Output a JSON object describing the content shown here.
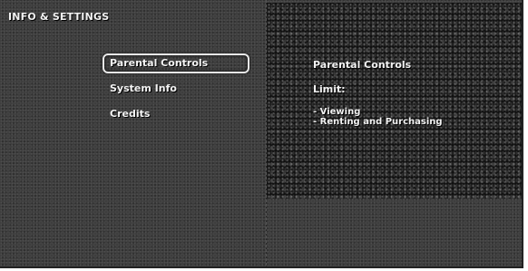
{
  "header": {
    "title": "INFO & SETTINGS"
  },
  "menu": {
    "items": [
      {
        "label": "Parental Controls",
        "selected": true
      },
      {
        "label": "System Info",
        "selected": false
      },
      {
        "label": "Credits",
        "selected": false
      }
    ]
  },
  "info_panel": {
    "title": "Parental Controls",
    "limit_label": "Limit:",
    "bullets": [
      "- Viewing",
      "- Renting and Purchasing"
    ]
  }
}
